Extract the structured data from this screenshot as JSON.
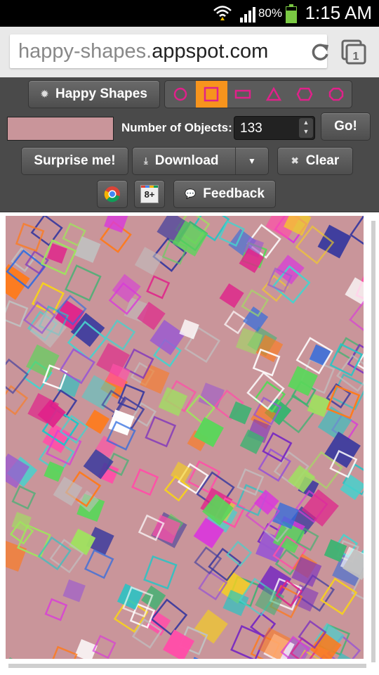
{
  "status_bar": {
    "battery": "80%",
    "time": "1:15 AM",
    "icons": [
      "wifi-icon",
      "signal-icon",
      "battery-icon"
    ]
  },
  "browser": {
    "url_subdomain": "happy-shapes.",
    "url_domain": "appspot.com",
    "icons": [
      "reload-icon",
      "tabs-icon"
    ],
    "tab_count": "1"
  },
  "toolbar": {
    "title_button": "Happy Shapes",
    "shapes": [
      "circle",
      "square",
      "rectangle",
      "triangle",
      "hexagon",
      "octagon"
    ],
    "selected_shape": "square",
    "number_label": "Number of Objects:",
    "number_value": "133",
    "go_button": "Go!",
    "surprise_button": "Surprise me!",
    "download_button": "Download",
    "clear_button": "Clear",
    "feedback_button": "Feedback",
    "gplus_label": "8+",
    "colors": {
      "background_swatch": "#c9959a",
      "shape_accent": "#e0218a",
      "active_shape": "#f7941d"
    }
  }
}
